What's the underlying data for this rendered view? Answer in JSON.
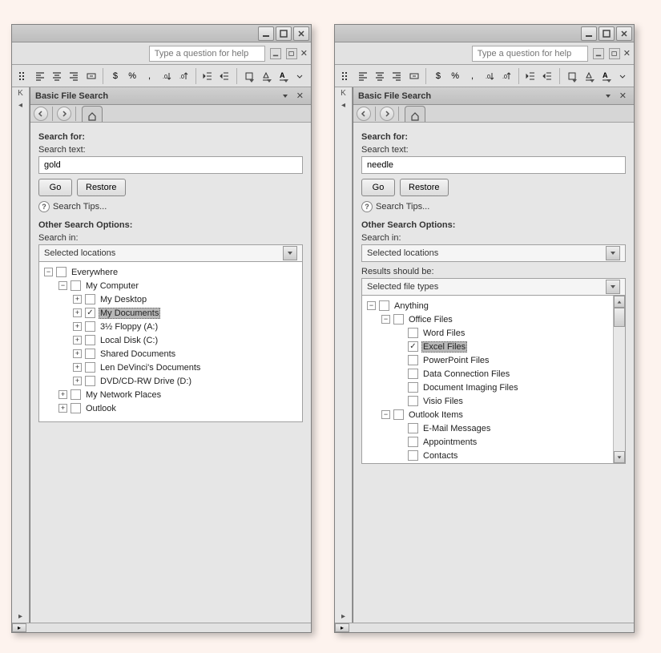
{
  "left": {
    "help_placeholder": "Type a question for help",
    "pane_title": "Basic File Search",
    "search_for_hdr": "Search for:",
    "search_text_lbl": "Search text:",
    "search_text_value": "gold",
    "go_btn": "Go",
    "restore_btn": "Restore",
    "tips": "Search Tips...",
    "other_hdr": "Other Search Options:",
    "search_in_lbl": "Search in:",
    "search_in_value": "Selected locations",
    "tree": {
      "n0": {
        "label": "Everywhere",
        "exp": "−"
      },
      "n1": {
        "label": "My Computer",
        "exp": "−"
      },
      "n2": {
        "label": "My Desktop",
        "exp": "+"
      },
      "n3": {
        "label": "My Documents",
        "exp": "+"
      },
      "n4": {
        "label": "3½ Floppy (A:)",
        "exp": "+"
      },
      "n5": {
        "label": "Local Disk (C:)",
        "exp": "+"
      },
      "n6": {
        "label": "Shared Documents",
        "exp": "+"
      },
      "n7": {
        "label": "Len DeVinci's Documents",
        "exp": "+"
      },
      "n8": {
        "label": "DVD/CD-RW Drive (D:)",
        "exp": "+"
      },
      "n9": {
        "label": "My Network Places",
        "exp": "+"
      },
      "n10": {
        "label": "Outlook",
        "exp": "+"
      }
    }
  },
  "right": {
    "help_placeholder": "Type a question for help",
    "pane_title": "Basic File Search",
    "search_for_hdr": "Search for:",
    "search_text_lbl": "Search text:",
    "search_text_value": "needle",
    "go_btn": "Go",
    "restore_btn": "Restore",
    "tips": "Search Tips...",
    "other_hdr": "Other Search Options:",
    "search_in_lbl": "Search in:",
    "search_in_value": "Selected locations",
    "results_lbl": "Results should be:",
    "results_value": "Selected file types",
    "tree": {
      "n0": {
        "label": "Anything",
        "exp": "−"
      },
      "n1": {
        "label": "Office Files",
        "exp": "−"
      },
      "n2": {
        "label": "Word Files"
      },
      "n3": {
        "label": "Excel Files"
      },
      "n4": {
        "label": "PowerPoint Files"
      },
      "n5": {
        "label": "Data Connection Files"
      },
      "n6": {
        "label": "Document Imaging Files"
      },
      "n7": {
        "label": "Visio Files"
      },
      "n8": {
        "label": "Outlook Items",
        "exp": "−"
      },
      "n9": {
        "label": "E-Mail Messages"
      },
      "n10": {
        "label": "Appointments"
      },
      "n11": {
        "label": "Contacts"
      }
    }
  },
  "toolbar": {
    "dollar": "$",
    "percent": "%",
    "comma": ",",
    "gutter_k": "K"
  }
}
